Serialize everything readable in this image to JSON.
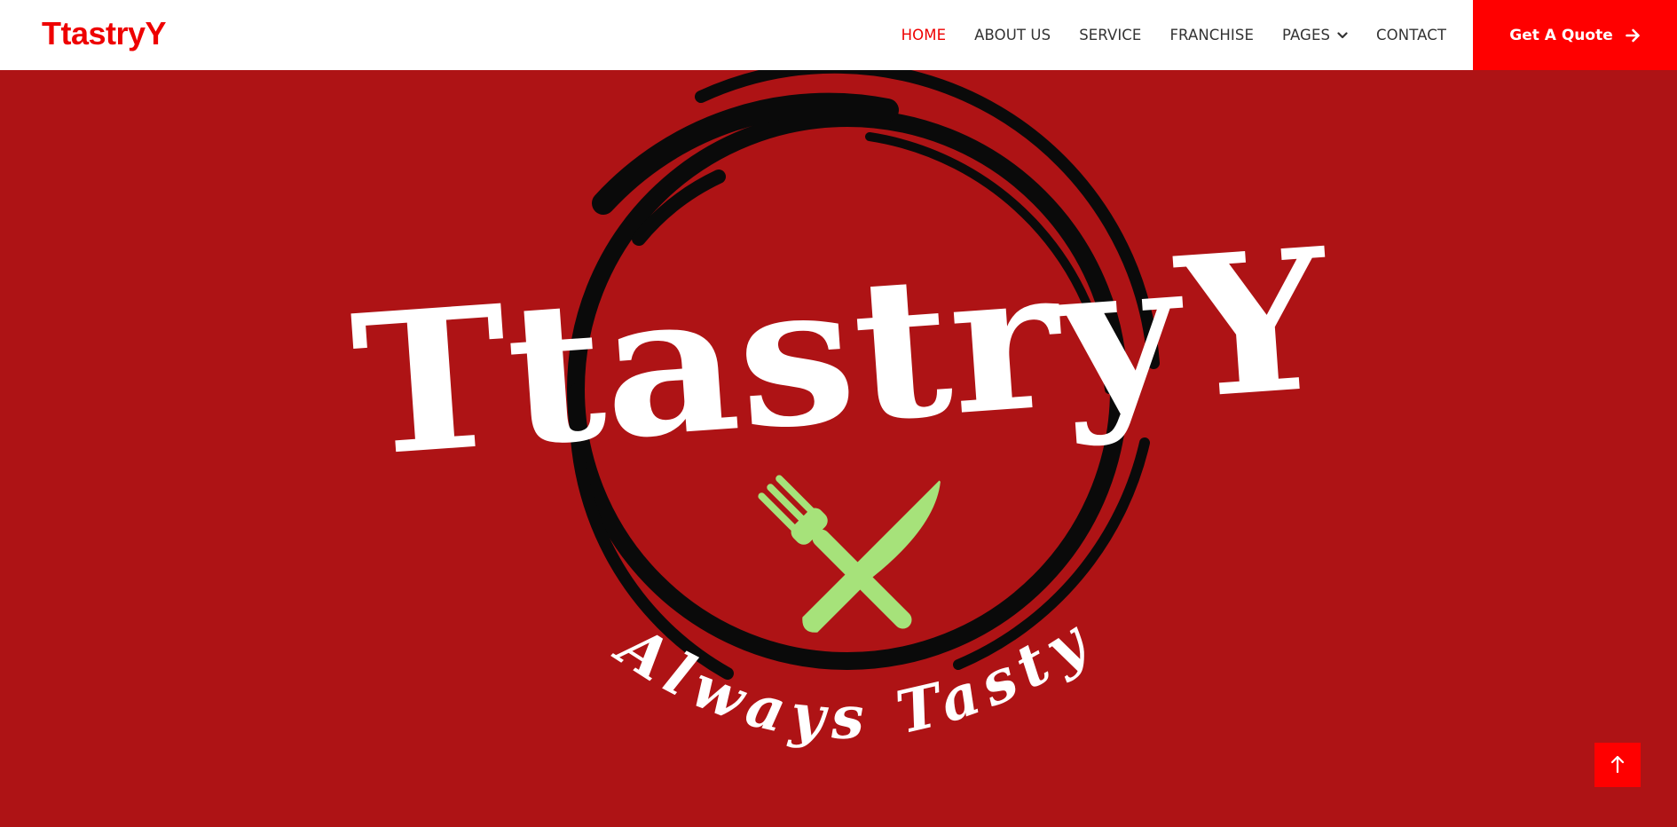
{
  "colors": {
    "brand_red": "#ee0000",
    "hero_bg": "#ae1315",
    "nav_text": "#333333",
    "white": "#ffffff",
    "cutlery_green": "#a6e27a",
    "ring_black": "#0a0a0a"
  },
  "header": {
    "brand": "TtastryY",
    "nav": [
      {
        "label": "HOME",
        "active": true
      },
      {
        "label": "ABOUT US",
        "active": false
      },
      {
        "label": "SERVICE",
        "active": false
      },
      {
        "label": "FRANCHISE",
        "active": false
      },
      {
        "label": "PAGES",
        "active": false,
        "icon": "chevron-down-icon"
      },
      {
        "label": "CONTACT",
        "active": false
      }
    ],
    "cta": {
      "label": "Get A Quote",
      "icon": "arrow-right-icon"
    }
  },
  "hero": {
    "logo_wordmark": "TtastryY",
    "logo_tagline": "Always Tasty",
    "logo_icon": "fork-knife-icon"
  },
  "back_to_top": {
    "icon": "arrow-up-icon"
  }
}
